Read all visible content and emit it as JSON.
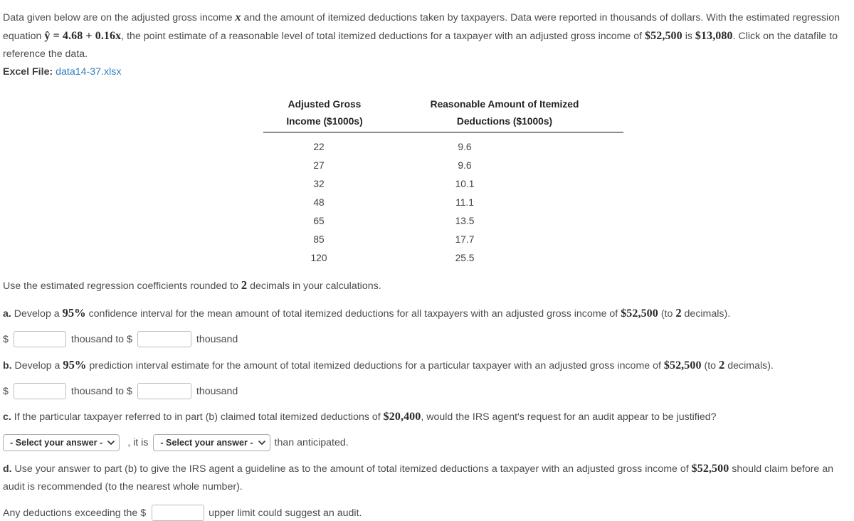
{
  "intro": {
    "text_1": "Data given below are on the adjusted gross income ",
    "math_x": "x",
    "text_2": " and the amount of itemized deductions taken by taxpayers. Data were reported in thousands of dollars. With the estimated regression equation ",
    "math_equation": "ŷ = 4.68 + 0.16x",
    "text_3": ", the point estimate of a reasonable level of total itemized deductions for a taxpayer with an adjusted gross income of ",
    "math_income": "$52,500",
    "text_4": " is ",
    "math_estimate": "$13,080",
    "text_5": ". Click on the datafile to reference the data."
  },
  "excel": {
    "label": "Excel File:",
    "filename": "data14-37.xlsx"
  },
  "table": {
    "headers": [
      "Adjusted Gross Income ($1000s)",
      "Reasonable Amount of Itemized Deductions ($1000s)"
    ],
    "header_lines": [
      [
        "Adjusted Gross",
        "Income ($1000s)"
      ],
      [
        "Reasonable Amount of Itemized",
        "Deductions ($1000s)"
      ]
    ],
    "rows": [
      [
        "22",
        "9.6"
      ],
      [
        "27",
        "9.6"
      ],
      [
        "32",
        "10.1"
      ],
      [
        "48",
        "11.1"
      ],
      [
        "65",
        "13.5"
      ],
      [
        "85",
        "17.7"
      ],
      [
        "120",
        "25.5"
      ]
    ]
  },
  "instruction": {
    "text_1": "Use the estimated regression coefficients rounded to ",
    "math_decimals": "2",
    "text_2": " decimals in your calculations."
  },
  "part_a": {
    "label": "a.",
    "text_1": " Develop a ",
    "math_level": "95%",
    "text_2": " confidence interval for the mean amount of total itemized deductions for all taxpayers with an adjusted gross income of ",
    "math_income": "$52,500",
    "text_3": " (to ",
    "math_decimals": "2",
    "text_4": " decimals).",
    "answer": {
      "dollar_prefix": "$",
      "value_lower": "",
      "value_upper": "",
      "placeholder": "",
      "mid_label": "thousand to $",
      "end_label": "thousand"
    }
  },
  "part_b": {
    "label": "b.",
    "text_1": " Develop a ",
    "math_level": "95%",
    "text_2": " prediction interval estimate for the amount of total itemized deductions for a particular taxpayer with an adjusted gross income of ",
    "math_income": "$52,500",
    "text_3": " (to ",
    "math_decimals": "2",
    "text_4": " decimals).",
    "answer": {
      "dollar_prefix": "$",
      "value_lower": "",
      "value_upper": "",
      "placeholder": "",
      "mid_label": "thousand to $",
      "end_label": "thousand"
    }
  },
  "part_c": {
    "label": "c.",
    "text_1": " If the particular taxpayer referred to in part (b) claimed total itemized deductions of ",
    "math_amount": "$20,400",
    "text_2": ", would the IRS agent's request for an audit appear to be justified?",
    "select_1": {
      "value": "- Select your answer -",
      "icon": "chevron-down-icon"
    },
    "middle_text": ", it is",
    "select_2": {
      "value": "- Select your answer -",
      "icon": "chevron-down-icon"
    },
    "trailing_text": "than anticipated."
  },
  "part_d": {
    "label": "d.",
    "text_1": " Use your answer to part (b) to give the IRS agent a guideline as to the amount of total itemized deductions a taxpayer with an adjusted gross income of ",
    "math_income": "$52,500",
    "text_2": " should claim before an audit is recommended (to the nearest whole number).",
    "answer": {
      "prefix_text": "Any deductions exceeding the $",
      "value": "",
      "placeholder": "",
      "suffix_text": "upper limit could suggest an audit."
    }
  },
  "colors": {
    "body_text": "#4a4c50",
    "math_text": "#2b2b2b",
    "link": "#2f7fc1",
    "rule": "#8c8c8c",
    "input_border": "#b9bcc0"
  }
}
